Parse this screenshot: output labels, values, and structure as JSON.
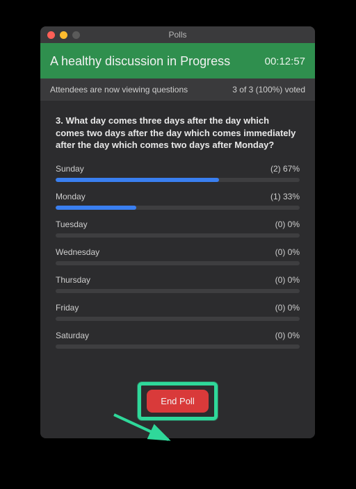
{
  "window": {
    "title": "Polls"
  },
  "header": {
    "title": "A healthy discussion in Progress",
    "timer": "00:12:57"
  },
  "status": {
    "left": "Attendees are now viewing questions",
    "right": "3 of 3 (100%) voted"
  },
  "question": {
    "text": "3. What day comes three days after the day which comes two days after the day which comes immediately after the day which comes two days after Monday?"
  },
  "options": [
    {
      "label": "Sunday",
      "count": "(2) 67%",
      "pct": 67
    },
    {
      "label": "Monday",
      "count": "(1) 33%",
      "pct": 33
    },
    {
      "label": "Tuesday",
      "count": "(0) 0%",
      "pct": 0
    },
    {
      "label": "Wednesday",
      "count": "(0) 0%",
      "pct": 0
    },
    {
      "label": "Thursday",
      "count": "(0) 0%",
      "pct": 0
    },
    {
      "label": "Friday",
      "count": "(0) 0%",
      "pct": 0
    },
    {
      "label": "Saturday",
      "count": "(0) 0%",
      "pct": 0
    }
  ],
  "footer": {
    "end_label": "End Poll"
  }
}
